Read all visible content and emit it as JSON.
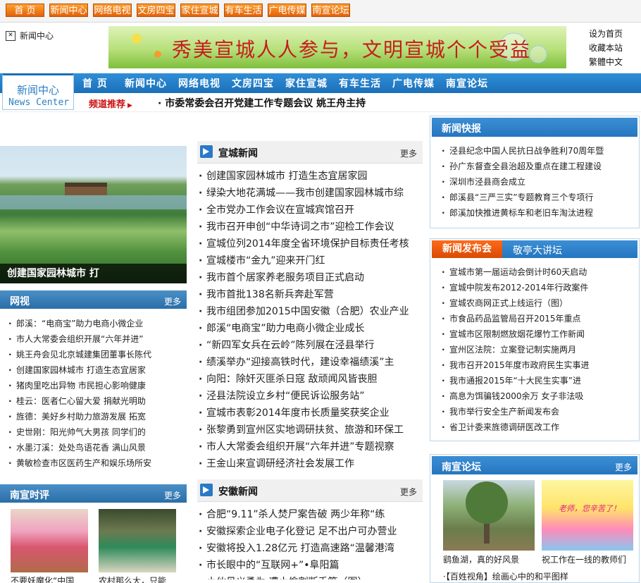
{
  "top_nav": [
    "首 页",
    "新闻中心",
    "网络电视",
    "文房四宝",
    "家住宣城",
    "有车生活",
    "广电传媒",
    "南宣论坛"
  ],
  "brand": {
    "label": "新闻中心"
  },
  "banner": {
    "slogan": "秀美宣城人人参与，文明宣城个个受益"
  },
  "quick_links": [
    "设为首页",
    "收藏本站",
    "繁體中文"
  ],
  "section_tab": {
    "zh": "新闻中心",
    "en": "News Center"
  },
  "main_nav": [
    "首 页",
    "新闻中心",
    "网络电视",
    "文房四宝",
    "家住宣城",
    "有车生活",
    "广电传媒",
    "南宣论坛"
  ],
  "recommend": {
    "label": "频道推荐",
    "headline": "· 市委常委会召开党建工作专题会议  姚王舟主持"
  },
  "photo_main": {
    "caption": "创建国家园林城市  打"
  },
  "video": {
    "title": "网视",
    "more": "更多",
    "items": [
      "郎溪：“电商宝”助力电商小微企业",
      "市人大常委会组织开展“六年并进”",
      "姚王舟会见北京城建集团董事长陈代",
      "创建国家园林城市  打造生态宜居家",
      "猪肉里吃出异物  市民担心影响健康",
      "桂云：医者仁心留大爱  捐献光明助",
      "旌德：美好乡村助力旅游发展  拓宽",
      "史世刚：阳光帅气大男孩  同学们的",
      "水墨汀溪：处处鸟语花香  满山风景",
      "黄敏检查市区医药生产和娱乐场所安"
    ]
  },
  "review": {
    "title": "南宣时评",
    "more": "更多",
    "captions": [
      "不要妖魔化“中国",
      "农村那么大，只能"
    ]
  },
  "xuancheng_news": {
    "title": "宣城新闻",
    "more": "更多",
    "items": [
      "创建国家园林城市  打造生态宜居家园",
      "绿染大地花满城——我市创建国家园林城市综",
      "全市党办工作会议在宣城宾馆召开",
      "我市召开申创“中华诗词之市”迎检工作会议",
      "宣城位列2014年度全省环境保护目标责任考核",
      "宣城楼市“金九”迎来开门红",
      "我市首个居家养老服务项目正式启动",
      "我市首批138名新兵奔赴军营",
      "我市组团参加2015中国安徽（合肥）农业产业",
      "郎溪“电商宝”助力电商小微企业成长",
      "“新四军女兵在云岭”陈列展在泾县举行",
      "绩溪举办“迎接高铁时代，建设幸福绩溪”主",
      "向阳：除奸灭匪杀日寇  敌顽闻风皆丧胆",
      "泾县法院设立乡村“便民诉讼服务站”",
      "宣城市表彰2014年度市长质量奖获奖企业",
      "张黎勇到宣州区实地调研扶贫、旅游和环保工",
      "市人大常委会组织开展“六年并进”专题视察",
      "王金山来宣调研经济社会发展工作"
    ]
  },
  "anhui_news": {
    "title": "安徽新闻",
    "more": "更多",
    "items": [
      "合肥“9.11”杀人焚尸案告破  两少年称“练",
      "安徽探索企业电子化登记  足不出户可办营业",
      "安徽将投入1.28亿元  打造高速路“温馨港湾",
      "市长眼中的“互联网+”•阜阳篇",
      "小伙见义勇为  遭小偷割断手筋（图）"
    ]
  },
  "kuaibao": {
    "title": "新闻快报",
    "items": [
      "泾县纪念中国人民抗日战争胜利70周年暨",
      "孙广东督查全县治超及重点在建工程建设",
      "深圳市泾县商会成立",
      "郎溪县“三严三实”专题教育三个专项行",
      "郎溪加快推进黄标车和老旧车淘汰进程"
    ]
  },
  "fabuhui": {
    "tab_active": "新闻发布会",
    "tab_other": "敬亭大讲坛",
    "items": [
      "宣城市第一届运动会倒计时60天启动",
      "宣城中院发布2012-2014年行政案件",
      "宣城农商网正式上线运行（图）",
      "市食品药品监管局召开2015年重点",
      "宣城市区限制燃放烟花爆竹工作新闻",
      "宣州区法院：立案登记制实施两月",
      "我市召开2015年度市政府民生实事进",
      "我市通报2015年“十大民生实事”进",
      "高息为饵骗钱2000余万  女子非法吸",
      "我市举行安全生产新闻发布会",
      "省卫计委来旌德调研医改工作"
    ]
  },
  "luntan": {
    "title": "南宣论坛",
    "more": "更多",
    "thumb_note": "老师，您辛苦了！",
    "captions": [
      "鹞鱼湖，真的好风景",
      "祝工作在一线的教师们"
    ],
    "bottom": "·【百姓视角】绘画心中的和平图样"
  },
  "colors": {
    "nav_blue": "#1b6fb8",
    "accent_orange": "#e2620a",
    "recommend_red": "#cc1111"
  }
}
